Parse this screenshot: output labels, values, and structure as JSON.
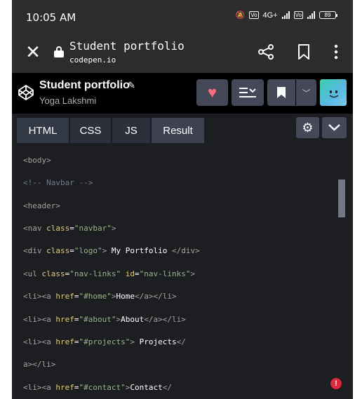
{
  "status_bar": {
    "time": "10:05 AM",
    "network_label": "4G+",
    "volte_label": "Vo LTE",
    "battery": "89"
  },
  "browser": {
    "page_title": "Student portfolio",
    "host": "codepen.io",
    "icons": [
      "close-icon",
      "lock-icon",
      "share-icon",
      "bookmark-icon",
      "more-icon"
    ]
  },
  "pen": {
    "title": "Student portfolio",
    "author": "Yoga Lakshmi",
    "actions": [
      "heart-icon",
      "layout-icon",
      "bookmark-icon",
      "chevron-down-icon"
    ]
  },
  "editor": {
    "tabs": [
      "HTML",
      "CSS",
      "JS",
      "Result"
    ],
    "code_lines": [
      [
        "<body>"
      ],
      [
        "<!-- Navbar -->"
      ],
      [
        "<header>"
      ],
      [
        "<nav ",
        "class",
        "=",
        "\"navbar\"",
        ">"
      ],
      [
        "<div ",
        "class",
        "=",
        "\"logo\"",
        ">",
        " My Portfolio ",
        "</div>"
      ],
      [
        "<ul ",
        "class",
        "=",
        "\"nav-links\"",
        " ",
        "id",
        "=",
        "\"nav-links\"",
        ">"
      ],
      [
        "<li><a ",
        "href",
        "=",
        "\"#home\"",
        ">",
        "Home",
        "</a></li>"
      ],
      [
        "<li><a ",
        "href",
        "=",
        "\"#about\"",
        ">",
        "About",
        "</a></li>"
      ],
      [
        "<li><a ",
        "href",
        "=",
        "\"#projects\"",
        ">",
        " Projects",
        "</"
      ],
      [
        "a></li>"
      ],
      [
        "<li><a ",
        "href",
        "=",
        "\"#contact\"",
        ">",
        "Contact",
        "</"
      ]
    ]
  },
  "colors": {
    "accent_heart": "#ff6b78",
    "error": "#e0263e",
    "editor_bg": "#1d1e22"
  }
}
